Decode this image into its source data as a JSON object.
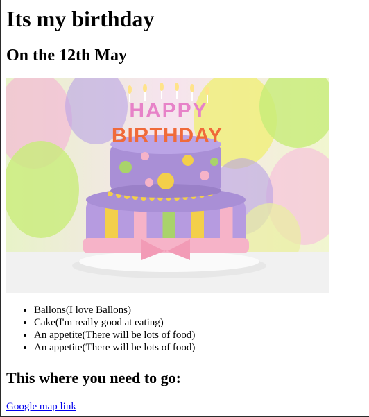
{
  "page": {
    "heading": "Its my birthday",
    "subheading": "On the 12th May",
    "image_alt": "Birthday cake with Happy Birthday candles",
    "list_items": [
      "Ballons(I love Ballons)",
      "Cake(I'm really good at eating)",
      "An appetite(There will be lots of food)",
      "An appetite(There will be lots of food)"
    ],
    "directions_heading": "This where you need to go:",
    "map_link_text": "Google map link"
  },
  "cake_text": {
    "happy": "HAPPY",
    "birthday": "BIRTHDAY"
  },
  "colors": {
    "link": "#0000ee",
    "cake_purple": "#a98fd6",
    "cake_pink": "#f6b3c8",
    "cake_yellow": "#f3cf4a",
    "cake_green": "#a9d36b"
  }
}
